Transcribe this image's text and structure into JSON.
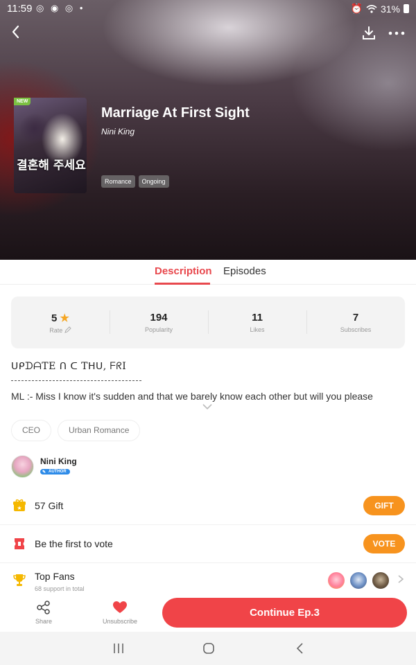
{
  "status_bar": {
    "time": "11:59",
    "left_icons": [
      "instagram-icon",
      "chat-icon",
      "instagram-icon",
      "dot-icon"
    ],
    "battery": "31%",
    "right_icons": [
      "alarm-icon",
      "wifi-icon",
      "battery-icon"
    ]
  },
  "header": {
    "icons": [
      "back-arrow-icon",
      "download-icon",
      "more-icon"
    ]
  },
  "comic": {
    "badge": "NEW",
    "cover_text": "결혼해 주세요",
    "title": "Marriage At First Sight",
    "author": "Nini King",
    "genres": [
      "Romance",
      "Ongoing"
    ]
  },
  "tabs": {
    "description": "Description",
    "episodes": "Episodes",
    "active": "Description"
  },
  "stats": [
    {
      "value": "5",
      "label": "Rate",
      "icon": "star-icon",
      "sub_icon": "pencil-icon"
    },
    {
      "value": "194",
      "label": "Popularity"
    },
    {
      "value": "11",
      "label": "Likes"
    },
    {
      "value": "7",
      "label": "Subscribes"
    }
  ],
  "description": {
    "update_line": "ᑌᑭᗪᗩTE ᑎ ᑕ Tᕼᑌ, ᖴᖇI",
    "text": "ML :- Miss I know it's sudden and that we barely know each other but will you please",
    "expand_icon": "chevron-down-icon"
  },
  "keyword_tags": [
    "CEO",
    "Urban Romance"
  ],
  "author_section": {
    "name": "Nini King",
    "badge": "AUTHOR"
  },
  "gift_row": {
    "count_label": "57 Gift",
    "button": "GIFT",
    "icon": "gift-icon"
  },
  "vote_row": {
    "label": "Be the first to vote",
    "button": "VOTE",
    "icon": "ticket-icon"
  },
  "fans_row": {
    "label": "Top Fans",
    "sub": "68 support in total",
    "icon": "trophy-icon"
  },
  "bottom_bar": {
    "share": "Share",
    "unsubscribe": "Unsubscribe",
    "continue": "Continue Ep.3"
  },
  "colors": {
    "accent": "#e8484d",
    "button_orange": "#f7931e",
    "continue_red": "#f04448",
    "star": "#f5a623"
  }
}
